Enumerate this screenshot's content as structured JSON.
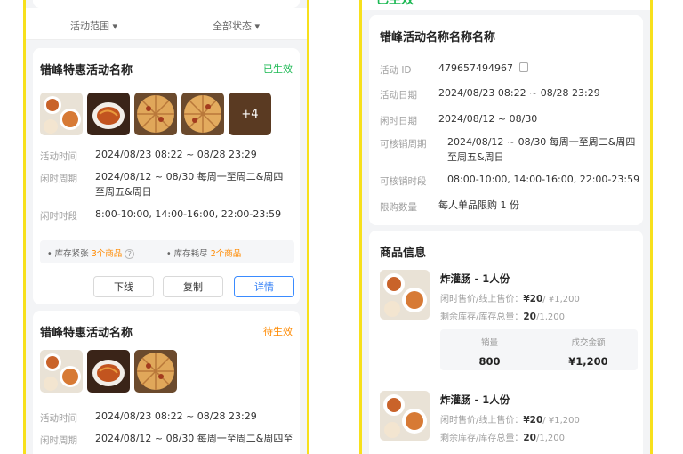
{
  "left": {
    "filters": [
      "活动范围",
      "全部状态"
    ],
    "cards": [
      {
        "title": "错峰特惠活动名称",
        "status": "已生效",
        "status_color": "#1db954",
        "more_count": "+4",
        "rows": [
          {
            "label": "活动时间",
            "value": "2024/08/23 08:22 ~ 08/28 23:29"
          },
          {
            "label": "闲时周期",
            "value": "2024/08/12 ~ 08/30 每周一至周二&周四至周五&周日"
          },
          {
            "label": "闲时时段",
            "value": "8:00-10:00, 14:00-16:00, 22:00-23:59"
          }
        ],
        "stock": {
          "tight_label": "库存紧张",
          "tight_count": "3个商品",
          "out_label": "库存耗尽",
          "out_count": "2个商品"
        },
        "buttons": {
          "offline": "下线",
          "copy": "复制",
          "detail": "详情"
        }
      },
      {
        "title": "错峰特惠活动名称",
        "status": "待生效",
        "status_color": "#ff8a00",
        "rows": [
          {
            "label": "活动时间",
            "value": "2024/08/23 08:22 ~ 08/28 23:29"
          },
          {
            "label": "闲时周期",
            "value": "2024/08/12 ~ 08/30 每周一至周二&周四至"
          }
        ]
      }
    ]
  },
  "right": {
    "header": "已生效",
    "title": "错峰活动名称名称名称",
    "rows": [
      {
        "label": "活动 ID",
        "value": "479657494967"
      },
      {
        "label": "活动日期",
        "value": "2024/08/23 08:22 ~ 08/28 23:29"
      },
      {
        "label": "闲时日期",
        "value": "2024/08/12 ~ 08/30"
      },
      {
        "label": "可核销周期",
        "value": "2024/08/12 ~ 08/30 每周一至周二&周四至周五&周日"
      },
      {
        "label": "可核销时段",
        "value": "08:00-10:00, 14:00-16:00, 22:00-23:59"
      },
      {
        "label": "限购数量",
        "value": "每人单品限购 1 份"
      }
    ],
    "products_title": "商品信息",
    "products": [
      {
        "name": "炸灌肠 - 1人份",
        "price_label": "闲时售价/线上售价：",
        "price_idle": "¥20",
        "price_online": "/ ¥1,200",
        "stock_label": "剩余库存/库存总量：",
        "stock_left": "20",
        "stock_total": "/1,200",
        "sales_label": "销量",
        "sales_value": "800",
        "amount_label": "成交金额",
        "amount_value": "¥1,200"
      },
      {
        "name": "炸灌肠 - 1人份",
        "price_label": "闲时售价/线上售价：",
        "price_idle": "¥20",
        "price_online": "/ ¥1,200",
        "stock_label": "剩余库存/库存总量：",
        "stock_left": "20",
        "stock_total": "/1,200"
      }
    ]
  }
}
